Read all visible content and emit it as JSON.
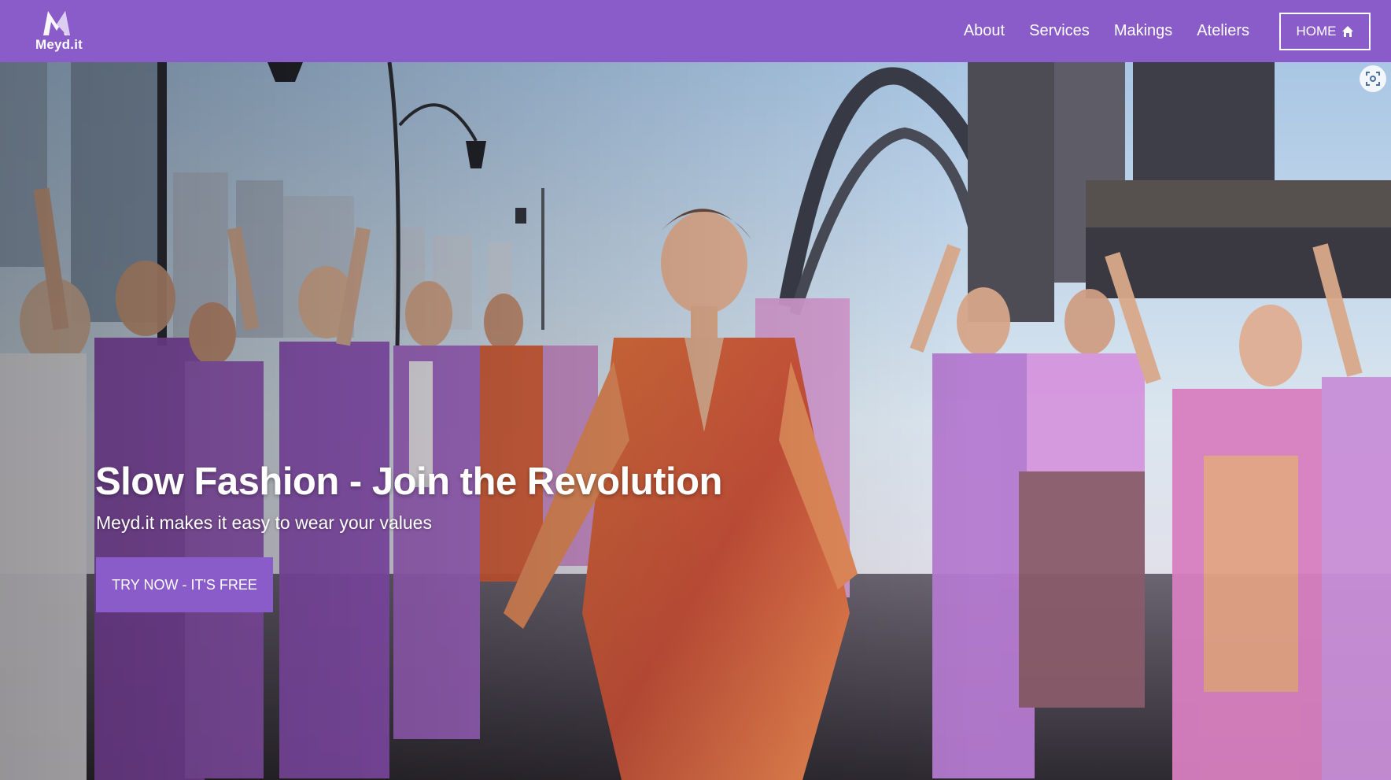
{
  "brand": {
    "name": "Meyd.it",
    "color": "#8a5cc9"
  },
  "nav": {
    "links": [
      "About",
      "Services",
      "Makings",
      "Ateliers"
    ],
    "home_label": "HOME",
    "home_icon": "home-icon"
  },
  "hero": {
    "title": "Slow Fashion - Join the Revolution",
    "subtitle": "Meyd.it makes it easy to wear your values",
    "cta_label": "TRY NOW - IT'S FREE",
    "scan_icon": "screen-capture-icon"
  }
}
